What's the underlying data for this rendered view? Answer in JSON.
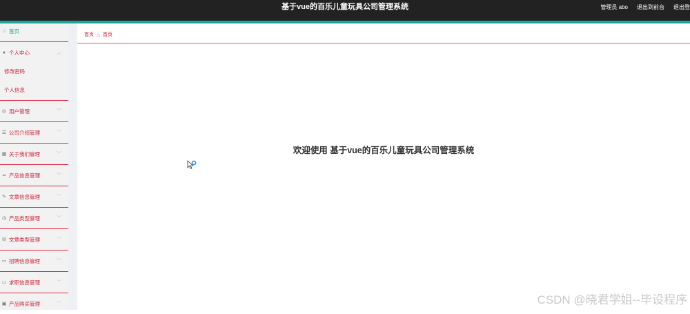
{
  "header": {
    "title": "基于vue的百乐儿童玩具公司管理系统",
    "admin_label": "管理员 abo",
    "goto_front": "退出到前台",
    "logout": "退出登录"
  },
  "sidebar": {
    "home": "首页",
    "personal_center": "个人中心",
    "change_password": "修改密码",
    "personal_info": "个人信息",
    "items": [
      {
        "label": "用户管理",
        "icon": "user-gear-icon"
      },
      {
        "label": "公司介绍管理",
        "icon": "list-icon"
      },
      {
        "label": "关于我们管理",
        "icon": "calendar-icon"
      },
      {
        "label": "产品信息管理",
        "icon": "grid-icon"
      },
      {
        "label": "文章信息管理",
        "icon": "edit-icon"
      },
      {
        "label": "产品类型管理",
        "icon": "clock-icon"
      },
      {
        "label": "文章类型管理",
        "icon": "message-icon"
      },
      {
        "label": "招聘信息管理",
        "icon": "monitor-icon"
      },
      {
        "label": "求职信息管理",
        "icon": "monitor-icon"
      },
      {
        "label": "产品购买管理",
        "icon": "box-icon"
      }
    ]
  },
  "breadcrumb": {
    "first": "首页",
    "current": "首页"
  },
  "main": {
    "welcome": "欢迎使用 基于vue的百乐儿童玩具公司管理系统"
  },
  "watermark": "CSDN @晓君学姐--毕设程序",
  "colors": {
    "topbar": "#222222",
    "accent": "#1aa59d",
    "menu_text": "#d0213a",
    "separator": "#dc2a44"
  }
}
